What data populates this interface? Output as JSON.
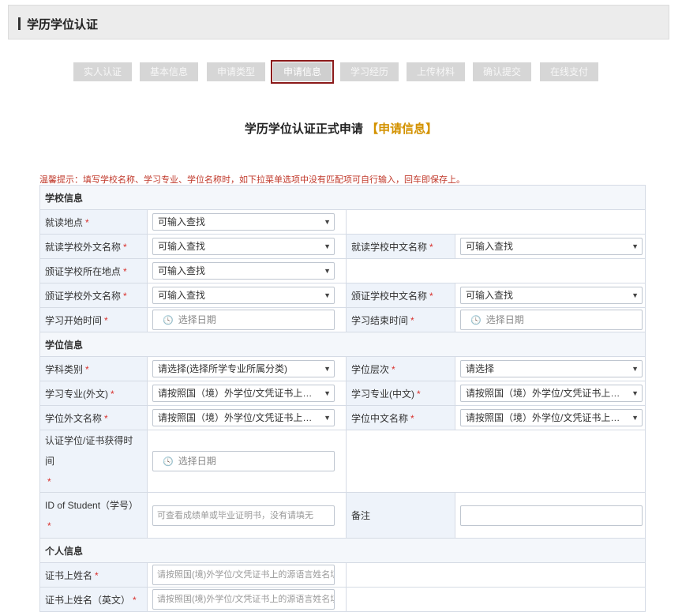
{
  "header": {
    "title": "学历学位认证"
  },
  "steps": [
    "实人认证",
    "基本信息",
    "申请类型",
    "申请信息",
    "学习经历",
    "上传材料",
    "确认提交",
    "在线支付"
  ],
  "active_step": "申请信息",
  "form": {
    "title": "学历学位认证正式申请",
    "subtitle": "【申请信息】",
    "tip": "温馨提示：填写学校名称、学习专业、学位名称时，如下拉菜单选项中没有匹配项可自行输入，回车即保存上。",
    "placeholders": {
      "search": "可输入查找",
      "date": "选择日期"
    },
    "sections": {
      "school": "学校信息",
      "degree": "学位信息",
      "personal": "个人信息"
    },
    "labels": {
      "study_location": "就读地点",
      "study_school_foreign": "就读学校外文名称",
      "study_school_cn": "就读学校中文名称",
      "issuing_school_location": "颁证学校所在地点",
      "issuing_school_foreign": "颁证学校外文名称",
      "issuing_school_cn": "颁证学校中文名称",
      "start_time": "学习开始时间",
      "end_time": "学习结束时间",
      "subject_category": "学科类别",
      "degree_level": "学位层次",
      "major_foreign": "学习专业(外文)",
      "major_cn": "学习专业(中文)",
      "degree_foreign": "学位外文名称",
      "degree_cn": "学位中文名称",
      "cert_time": "认证学位/证书获得时间",
      "student_id": "ID of Student（学号）",
      "remark": "备注",
      "name_on_cert": "证书上姓名",
      "name_on_cert_en": "证书上姓名（英文）"
    },
    "values": {
      "subject_category": "请选择(选择所学专业所属分类)",
      "degree_level": "请选择",
      "major_foreign": "请按照国（境）外学位/文凭证书上内容填写",
      "major_cn": "请按照国（境）外学位/文凭证书上内容填写",
      "degree_foreign": "请按照国（境）外学位/文凭证书上内容...",
      "degree_cn": "请按照国（境）外学位/文凭证书上内容..."
    },
    "input_placeholders": {
      "student_id": "可查看成绩单或毕业证明书，没有请填无",
      "name_on_cert": "请按照国(境)外学位/文凭证书上的源语言姓名填写",
      "name_on_cert_en": "请按照国(境)外学位/文凭证书上的源语言姓名填写"
    },
    "required_mark": "*"
  }
}
